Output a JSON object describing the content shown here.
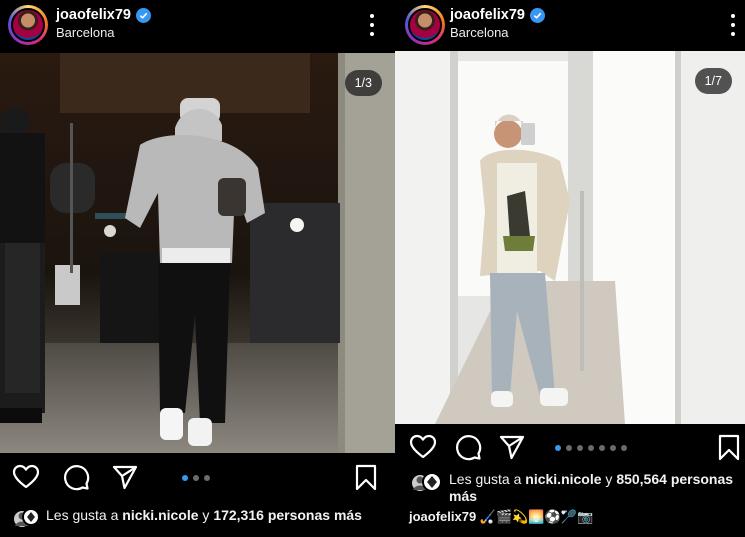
{
  "posts": [
    {
      "username": "joaofelix79",
      "location": "Barcelona",
      "counter": "1/3",
      "likes_prefix": "Les gusta a",
      "likes_user": "nicki.nicole",
      "likes_suffix": "y",
      "likes_count": "172,316",
      "likes_tail": "personas más"
    },
    {
      "username": "joaofelix79",
      "location": "Barcelona",
      "counter": "1/7",
      "likes_prefix": "Les gusta a",
      "likes_user": "nicki.nicole",
      "likes_suffix": "y",
      "likes_count": "850,564",
      "likes_tail": "personas más",
      "caption_user": "joaofelix79",
      "caption_text": "🏑🎬💫🌅⚽🏸📷"
    }
  ],
  "colors": {
    "accent": "#3897f0",
    "background": "#000000",
    "verified": "#3897f0"
  },
  "icons": [
    "heart-icon",
    "comment-icon",
    "share-icon",
    "bookmark-icon",
    "verified-icon",
    "more-options-icon"
  ]
}
